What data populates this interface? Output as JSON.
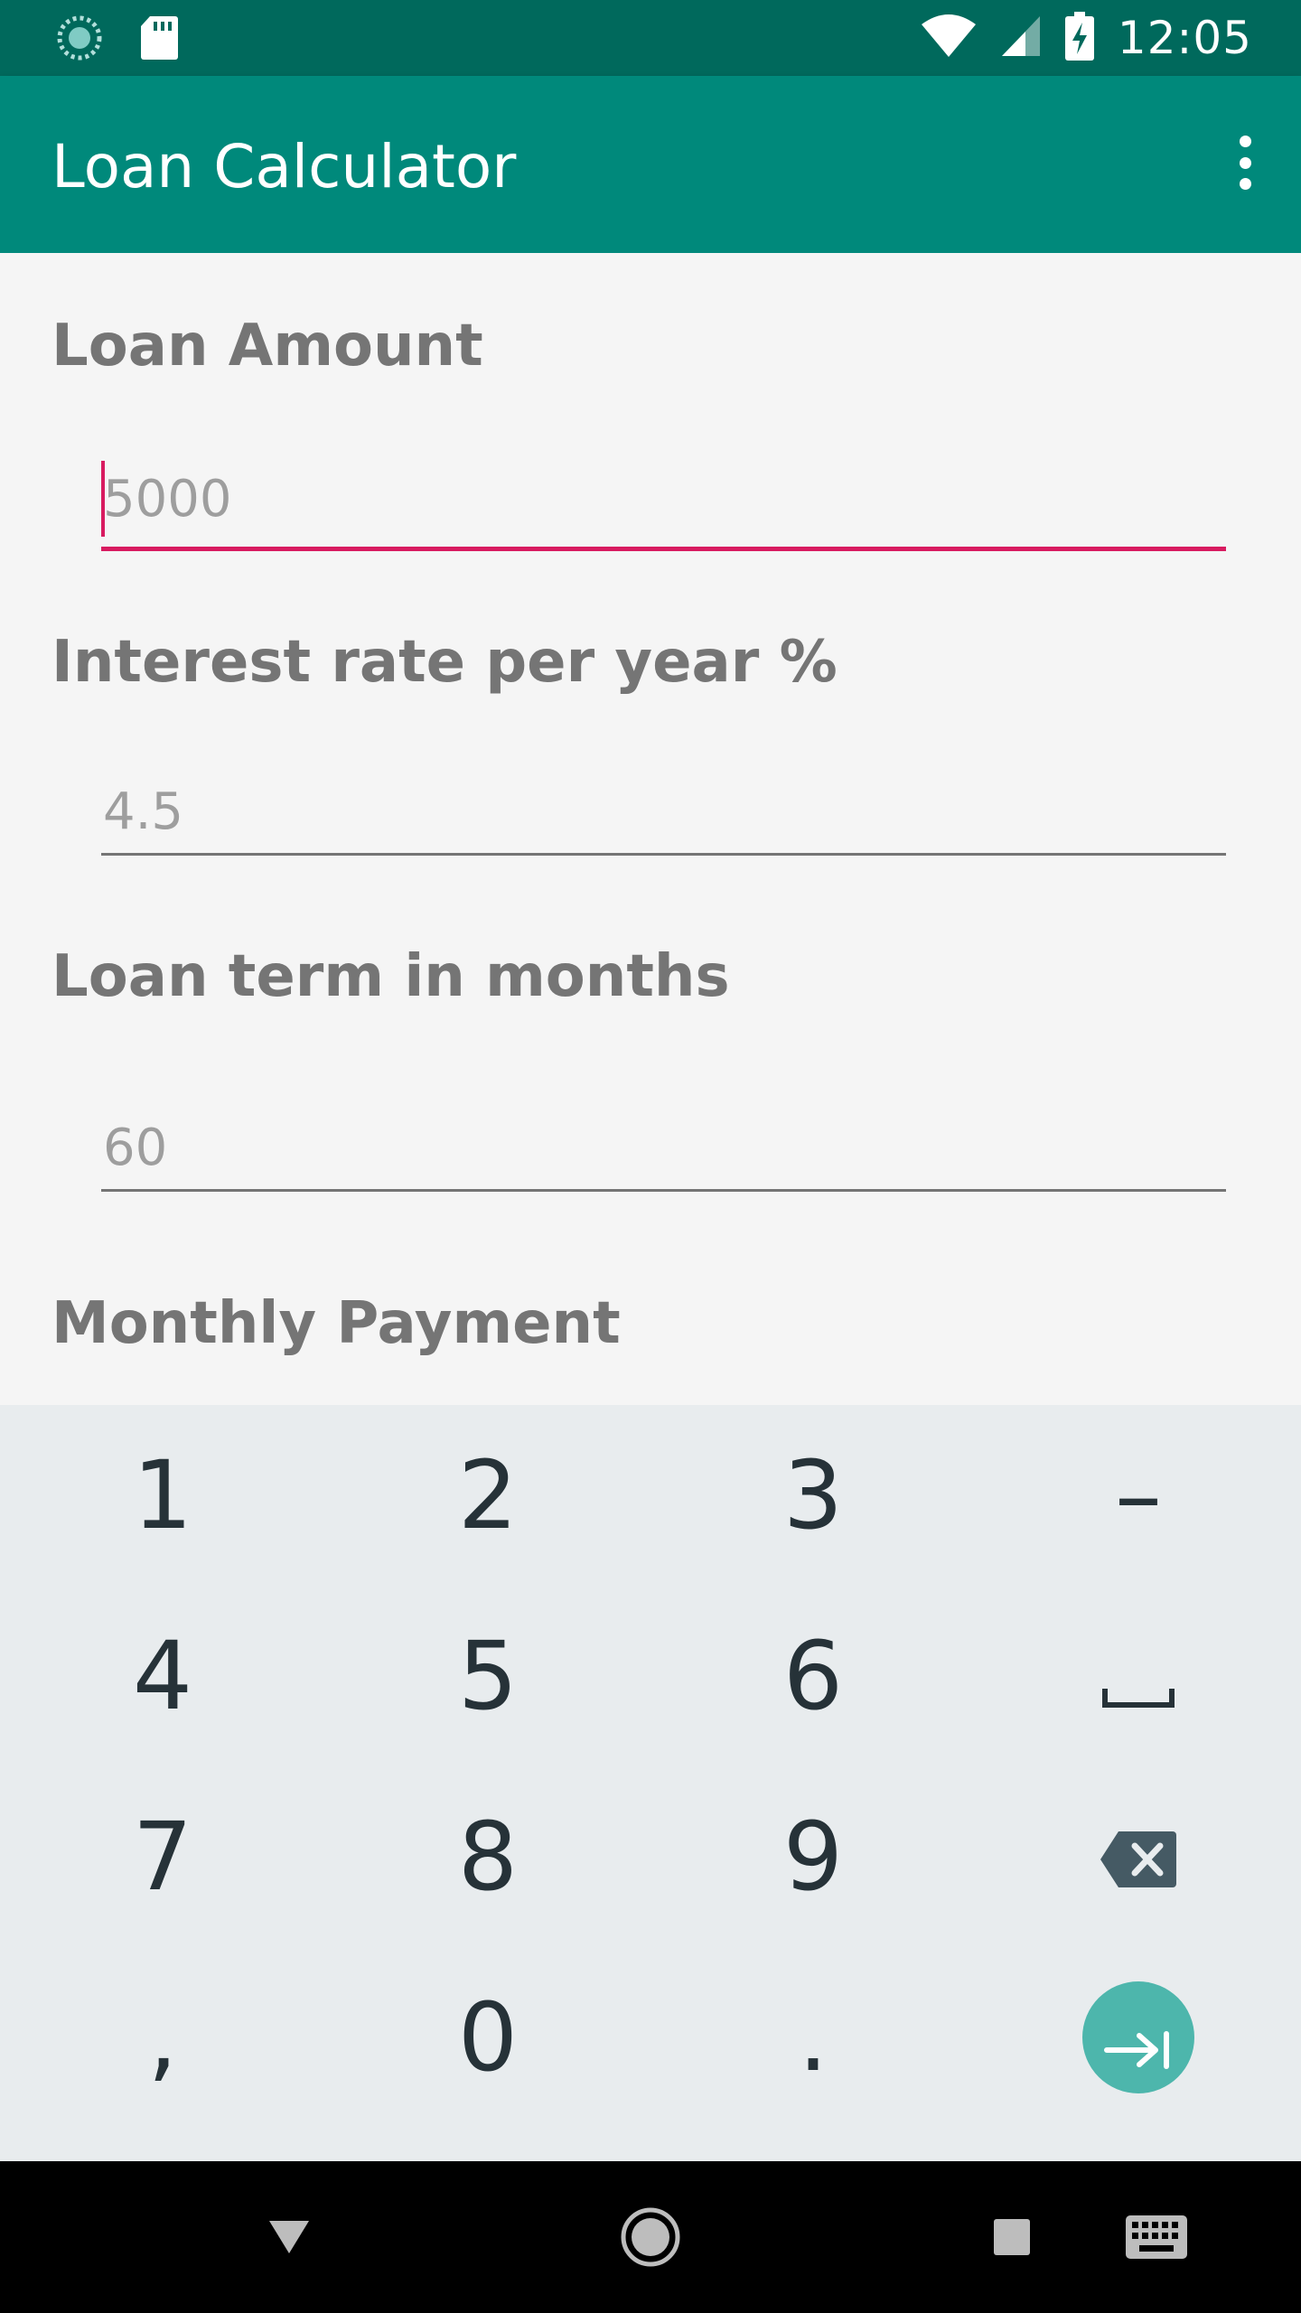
{
  "status_bar": {
    "time": "12:05",
    "icons": [
      "sync-icon",
      "sd-card-icon",
      "wifi-icon",
      "signal-icon",
      "battery-charging-icon"
    ]
  },
  "app_bar": {
    "title": "Loan Calculator",
    "overflow_icon": "more-vert-icon"
  },
  "form": {
    "loan_amount": {
      "label": "Loan Amount",
      "placeholder": "5000"
    },
    "interest_rate": {
      "label": "Interest rate per year %",
      "placeholder": "4.5"
    },
    "loan_term": {
      "label": "Loan term in months",
      "placeholder": "60"
    },
    "monthly_payment": {
      "label": "Monthly Payment"
    }
  },
  "keyboard": {
    "rows": [
      [
        "1",
        "2",
        "3",
        "–"
      ],
      [
        "4",
        "5",
        "6",
        "space"
      ],
      [
        "7",
        "8",
        "9",
        "backspace"
      ],
      [
        ",",
        "0",
        ".",
        "next"
      ]
    ]
  },
  "nav_bar": {
    "icons": [
      "back-icon",
      "home-icon",
      "recents-icon",
      "keyboard-switch-icon"
    ]
  },
  "colors": {
    "status_bar": "#00695c",
    "app_bar": "#00897b",
    "accent": "#d81b60",
    "keyboard_bg": "#e8ecee",
    "action_key": "#4db6ac"
  }
}
